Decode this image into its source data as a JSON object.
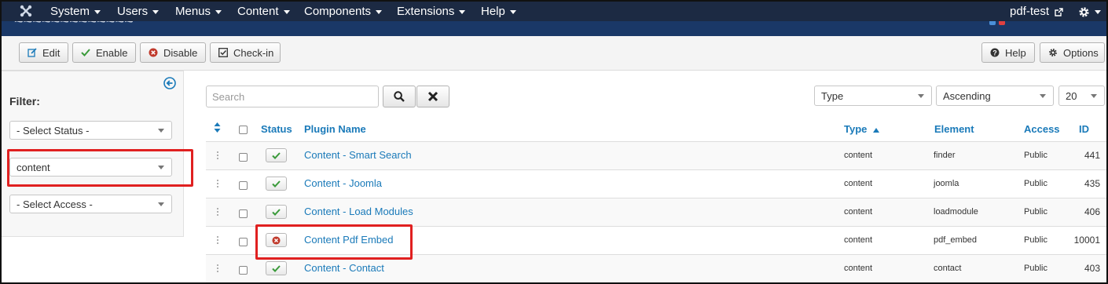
{
  "nav": {
    "menus": [
      "System",
      "Users",
      "Menus",
      "Content",
      "Components",
      "Extensions",
      "Help"
    ],
    "site_name": "pdf-test"
  },
  "toolbar": {
    "edit": "Edit",
    "enable": "Enable",
    "disable": "Disable",
    "checkin": "Check-in",
    "help": "Help",
    "options": "Options"
  },
  "sidebar": {
    "filter_label": "Filter:",
    "status_select": "- Select Status -",
    "folder_select": "content",
    "access_select": "- Select Access -"
  },
  "search": {
    "placeholder": "Search",
    "sort_field": "Type",
    "sort_dir": "Ascending",
    "limit": "20"
  },
  "table": {
    "headers": {
      "status": "Status",
      "name": "Plugin Name",
      "type": "Type",
      "element": "Element",
      "access": "Access",
      "id": "ID"
    },
    "rows": [
      {
        "enabled": true,
        "name": "Content - Smart Search",
        "type": "content",
        "element": "finder",
        "access": "Public",
        "id": "441"
      },
      {
        "enabled": true,
        "name": "Content - Joomla",
        "type": "content",
        "element": "joomla",
        "access": "Public",
        "id": "435"
      },
      {
        "enabled": true,
        "name": "Content - Load Modules",
        "type": "content",
        "element": "loadmodule",
        "access": "Public",
        "id": "406"
      },
      {
        "enabled": false,
        "name": "Content Pdf Embed",
        "type": "content",
        "element": "pdf_embed",
        "access": "Public",
        "id": "10001"
      },
      {
        "enabled": true,
        "name": "Content - Contact",
        "type": "content",
        "element": "contact",
        "access": "Public",
        "id": "403"
      }
    ]
  },
  "colors": {
    "navbar": "#1c2a43",
    "link": "#1a7ab9",
    "highlight": "#e02020",
    "enabled": "#3a9a3a",
    "disabled": "#c0392b"
  }
}
